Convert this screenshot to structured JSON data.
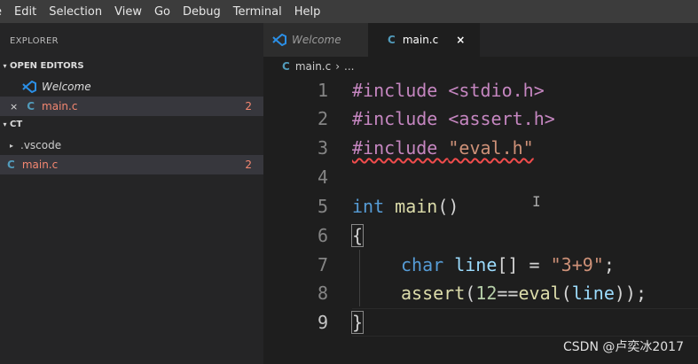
{
  "menubar": {
    "items": [
      "e",
      "Edit",
      "Selection",
      "View",
      "Go",
      "Debug",
      "Terminal",
      "Help"
    ]
  },
  "sidebar": {
    "title": "EXPLORER",
    "open_editors": {
      "label": "OPEN EDITORS",
      "items": [
        {
          "name": "Welcome",
          "icon": "vscode-icon"
        },
        {
          "name": "main.c",
          "icon": "c-file-icon",
          "close": "×",
          "badge": "2"
        }
      ]
    },
    "folder": {
      "label": "CT",
      "items": [
        {
          "name": ".vscode",
          "icon": "chevron-right-icon"
        },
        {
          "name": "main.c",
          "icon": "c-file-icon",
          "badge": "2"
        }
      ]
    }
  },
  "tabs": [
    {
      "label": "Welcome",
      "icon": "vscode-icon"
    },
    {
      "label": "main.c",
      "icon": "c-file-icon",
      "close": "×"
    }
  ],
  "breadcrumb": {
    "file": "main.c",
    "sep": "›",
    "more": "..."
  },
  "editor": {
    "line_numbers": [
      "1",
      "2",
      "3",
      "4",
      "5",
      "6",
      "7",
      "8",
      "9"
    ],
    "lines": [
      [
        "#include ",
        "<stdio.h>"
      ],
      [
        "#include ",
        "<assert.h>"
      ],
      [
        "#include ",
        "\"eval.h\""
      ],
      [],
      [
        "int",
        " ",
        "main",
        "()"
      ],
      [
        "{"
      ],
      [
        "char",
        " ",
        "line",
        "[]",
        " = ",
        "\"3+9\"",
        ";"
      ],
      [
        "assert",
        "(",
        "12",
        "==",
        "eval",
        "(",
        "line",
        "));"
      ],
      [
        "}"
      ]
    ],
    "cursor_glyph": "I"
  },
  "watermark": "CSDN @卢奕冰2017",
  "colors": {
    "bg": "#1e1e1e",
    "sidebar": "#252526",
    "menubar": "#3c3c3c",
    "preprocessor": "#c586c0",
    "string": "#ce9178",
    "type": "#569cd6",
    "function": "#dcdcaa",
    "number": "#b5cea8",
    "error": "#f48771"
  }
}
